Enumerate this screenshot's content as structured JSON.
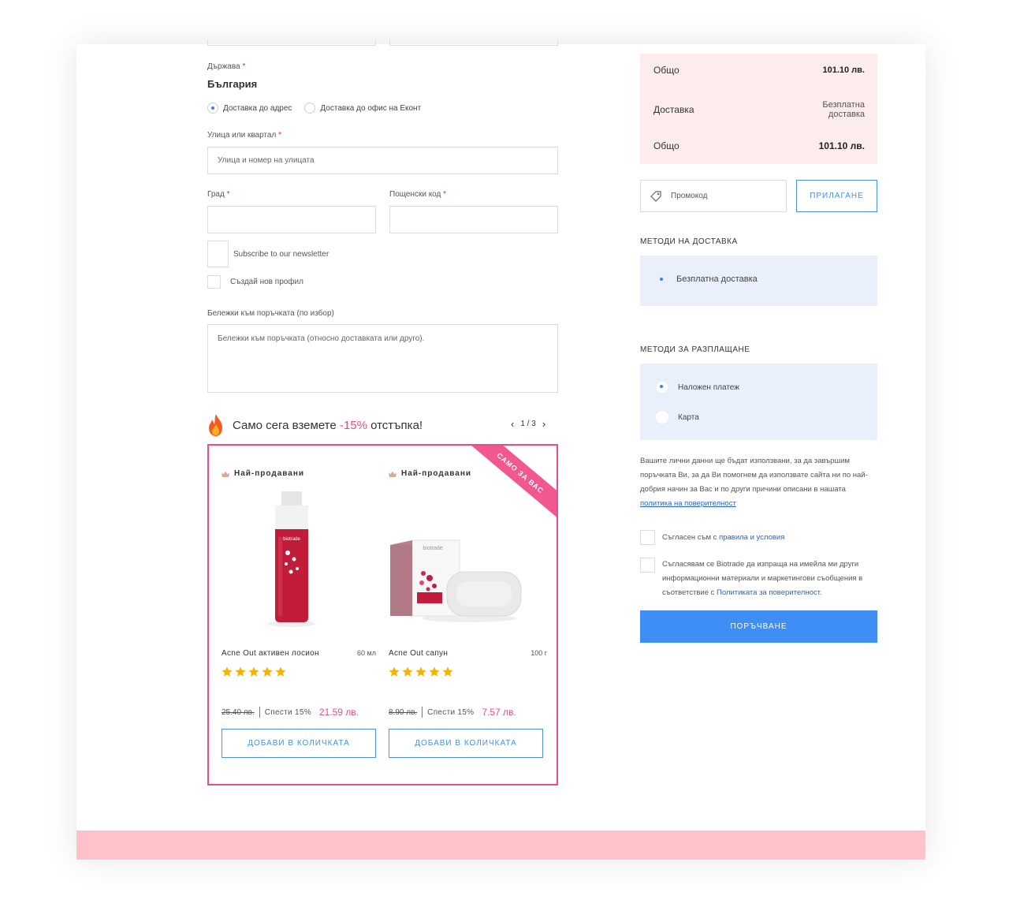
{
  "address": {
    "country_label": "Държава",
    "country_value": "България",
    "delivery_type": {
      "option1": "Доставка до адрес",
      "option2": "Доставка до офис на Еконт"
    },
    "street_label": "Улица или квартал",
    "street_placeholder": "Улица и номер на улицата",
    "city_label": "Град",
    "postcode_label": "Пощенски код",
    "newsletter_label": "Subscribe to our newsletter",
    "create_account_label": "Създай нов профил",
    "notes_label": "Бележки към поръчката (по избор)",
    "notes_placeholder": "Бележки към поръчката (относно доставката или друго)."
  },
  "promo": {
    "title_before": "Само сега вземете",
    "title_pct": "-15%",
    "title_after": "отстъпка!",
    "pager": "1 / 3",
    "ribbon": "САМО ЗА ВАС",
    "products": [
      {
        "badge": "Най-продавани",
        "name": "Acne Out активен лосион",
        "size": "60 мл",
        "rating": 5,
        "old_price": "25.40 лв.",
        "save": "Спести 15%",
        "new_price": "21.59 лв.",
        "button": "ДОБАВИ В КОЛИЧКАТА",
        "image_text": "biotrade"
      },
      {
        "badge": "Най-продавани",
        "name": "Acne Out сапун",
        "size": "100 г",
        "rating": 5,
        "old_price": "8.90 лв.",
        "save": "Спести 15%",
        "new_price": "7.57 лв.",
        "button": "ДОБАВИ В КОЛИЧКАТА",
        "image_text": "biotrade"
      }
    ]
  },
  "summary": {
    "subtotal_label": "Общо",
    "subtotal_value": "101.10 лв.",
    "delivery_label": "Доставка",
    "delivery_value_1": "Безплатна",
    "delivery_value_2": "доставка",
    "total_label": "Общо",
    "total_value": "101.10 лв."
  },
  "promocode": {
    "placeholder": "Промокод",
    "apply_button": "ПРИЛАГАНЕ"
  },
  "shipping": {
    "title": "МЕТОДИ НА ДОСТАВКА",
    "option": "Безплатна доставка"
  },
  "payment": {
    "title": "МЕТОДИ ЗА РАЗПЛАЩАНЕ",
    "option_cod": "Наложен платеж",
    "option_card": "Карта"
  },
  "privacy": {
    "text": "Вашите лични данни ще бъдат използвани, за да завършим поръчката Ви, за да Ви помогнем да използвате сайта ни по най-добрия начин за Вас и по други причини описани в нашата",
    "link": "политика на поверителност"
  },
  "terms": {
    "text": "Съгласен съм с",
    "link": "правила и условия"
  },
  "marketing": {
    "text": "Съгласявам се Biotrade да изпраща на имейла ми други информационни материали и маркетингови съобщения в съответствие с",
    "link": "Политиката за поверителност."
  },
  "order_button": "ПОРЪЧВАНЕ",
  "colors": {
    "accent_pink": "#e84c8a",
    "accent_blue": "#3f8ef5",
    "summary_bg": "#fdecec",
    "options_bg": "#eaf0fb",
    "footer_band": "#ffc2cb",
    "star": "#f5b301"
  }
}
